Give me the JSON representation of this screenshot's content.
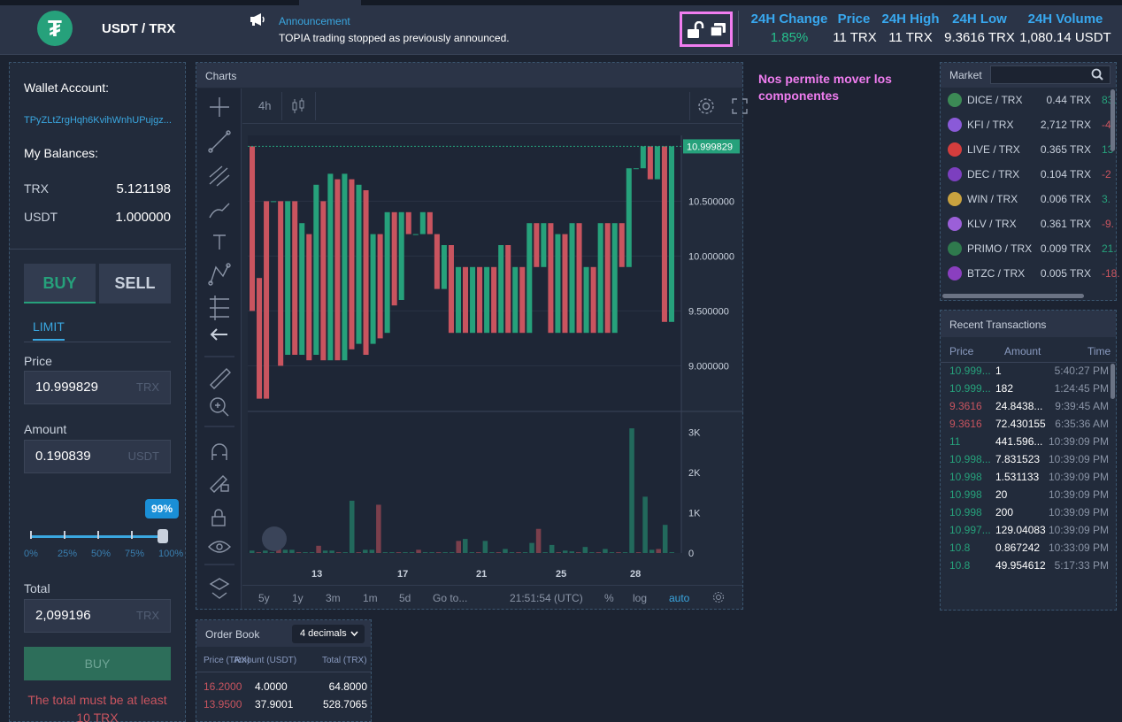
{
  "header": {
    "pair": "USDT / TRX",
    "announcement_title": "Announcement",
    "announcement_text": "TOPIA trading stopped as previously announced.",
    "stats": [
      {
        "label": "24H Change",
        "value": "1.85%"
      },
      {
        "label": "Price",
        "value": "11 TRX"
      },
      {
        "label": "24H High",
        "value": "11 TRX"
      },
      {
        "label": "24H Low",
        "value": "9.3616 TRX"
      },
      {
        "label": "24H Volume",
        "value": "1,080.14 USDT"
      }
    ]
  },
  "annotation_note": "Nos permite mover los componentes",
  "wallet": {
    "title": "Wallet Account:",
    "address": "TPyZLtZrgHqh6KvihWnhUPujgz...",
    "balances_title": "My Balances:",
    "balances": [
      {
        "asset": "TRX",
        "amount": "5.121198"
      },
      {
        "asset": "USDT",
        "amount": "1.000000"
      }
    ]
  },
  "trade": {
    "buy_tab": "BUY",
    "sell_tab": "SELL",
    "order_type": "LIMIT",
    "price_label": "Price",
    "price_value": "10.999829",
    "price_unit": "TRX",
    "amount_label": "Amount",
    "amount_value": "0.190839",
    "amount_unit": "USDT",
    "slider_pct": "99%",
    "slider_value": 0.99,
    "slider_marks": [
      "0%",
      "25%",
      "50%",
      "75%",
      "100%"
    ],
    "total_label": "Total",
    "total_value": "2,099196",
    "total_unit": "TRX",
    "submit_label": "BUY",
    "error": "The total must be at least 10 TRX"
  },
  "chart": {
    "title": "Charts",
    "interval": "4h",
    "last_price_label": "10.999829",
    "price_ticks": [
      "10.500000",
      "10.000000",
      "9.500000",
      "9.000000"
    ],
    "volume_ticks": [
      "3K",
      "2K",
      "1K",
      "0"
    ],
    "x_ticks": [
      "13",
      "17",
      "21",
      "25",
      "28"
    ],
    "ranges": [
      "5y",
      "1y",
      "3m",
      "1m",
      "5d",
      "Go to..."
    ],
    "time": "21:51:54 (UTC)",
    "pct": "%",
    "log": "log",
    "auto": "auto"
  },
  "chart_data": {
    "type": "candlestick",
    "title": "",
    "ylim": [
      8.6,
      11.1
    ],
    "volume_ylim": [
      0,
      3300
    ],
    "x_tick_labels": [
      "13",
      "17",
      "21",
      "25",
      "28"
    ],
    "candles": [
      [
        11.0,
        10.95,
        9.5,
        9.5
      ],
      [
        9.8,
        9.8,
        8.7,
        8.7
      ],
      [
        10.5,
        10.5,
        8.7,
        8.7
      ],
      [
        10.5,
        10.5,
        10.5,
        10.5
      ],
      [
        10.5,
        10.5,
        9.0,
        9.0
      ],
      [
        9.1,
        10.5,
        9.1,
        10.5
      ],
      [
        10.5,
        10.5,
        9.1,
        9.1
      ],
      [
        9.1,
        10.3,
        9.1,
        10.3
      ],
      [
        10.2,
        10.2,
        9.05,
        9.05
      ],
      [
        9.1,
        10.65,
        9.1,
        10.65
      ],
      [
        10.5,
        10.5,
        9.05,
        9.05
      ],
      [
        9.05,
        10.75,
        9.05,
        10.75
      ],
      [
        10.7,
        10.7,
        9.05,
        9.05
      ],
      [
        9.05,
        10.75,
        9.05,
        10.75
      ],
      [
        10.7,
        10.7,
        9.15,
        9.15
      ],
      [
        9.2,
        10.65,
        9.2,
        10.65
      ],
      [
        10.6,
        10.6,
        9.1,
        9.1
      ],
      [
        9.2,
        10.2,
        9.2,
        10.2
      ],
      [
        10.2,
        10.2,
        9.25,
        9.25
      ],
      [
        9.3,
        10.4,
        9.3,
        10.4
      ],
      [
        10.4,
        10.4,
        9.55,
        9.55
      ],
      [
        9.6,
        10.4,
        9.6,
        10.4
      ],
      [
        10.4,
        10.4,
        10.2,
        10.2
      ],
      [
        10.2,
        10.2,
        10.2,
        10.2
      ],
      [
        10.2,
        10.4,
        10.2,
        10.4
      ],
      [
        10.4,
        10.4,
        10.2,
        10.2
      ],
      [
        10.2,
        10.2,
        9.7,
        9.7
      ],
      [
        9.7,
        10.1,
        9.7,
        10.1
      ],
      [
        10.1,
        10.1,
        9.3,
        9.3
      ],
      [
        9.3,
        9.9,
        9.3,
        9.9
      ],
      [
        9.9,
        9.9,
        9.3,
        9.3
      ],
      [
        9.3,
        9.9,
        9.3,
        9.9
      ],
      [
        9.9,
        9.9,
        9.3,
        9.3
      ],
      [
        9.3,
        9.9,
        9.3,
        9.9
      ],
      [
        9.9,
        9.9,
        9.3,
        9.3
      ],
      [
        9.3,
        10.1,
        9.3,
        10.1
      ],
      [
        10.1,
        10.1,
        9.3,
        9.3
      ],
      [
        9.3,
        9.9,
        9.3,
        9.9
      ],
      [
        9.9,
        9.9,
        9.3,
        9.3
      ],
      [
        9.3,
        10.3,
        9.3,
        10.3
      ],
      [
        10.3,
        10.3,
        9.9,
        9.9
      ],
      [
        9.9,
        10.3,
        9.9,
        10.3
      ],
      [
        10.3,
        10.3,
        9.3,
        9.3
      ],
      [
        9.3,
        10.2,
        9.3,
        10.2
      ],
      [
        10.2,
        10.2,
        9.3,
        9.3
      ],
      [
        9.3,
        10.3,
        9.3,
        10.3
      ],
      [
        10.3,
        10.3,
        9.3,
        9.3
      ],
      [
        9.3,
        9.9,
        9.3,
        9.9
      ],
      [
        9.9,
        9.9,
        9.3,
        9.3
      ],
      [
        9.3,
        10.3,
        9.3,
        10.3
      ],
      [
        10.3,
        10.3,
        9.3,
        9.3
      ],
      [
        9.3,
        10.3,
        9.3,
        10.3
      ],
      [
        10.3,
        10.3,
        9.9,
        9.9
      ],
      [
        9.9,
        10.8,
        9.9,
        10.8
      ],
      [
        10.8,
        10.8,
        10.8,
        10.8
      ],
      [
        10.8,
        11.0,
        10.8,
        11.0
      ],
      [
        11.0,
        11.0,
        10.7,
        10.7
      ],
      [
        10.7,
        11.0,
        10.7,
        11.0
      ],
      [
        11.0,
        11.0,
        9.4,
        9.4
      ],
      [
        9.4,
        11.0,
        9.4,
        11.0
      ]
    ],
    "volumes": [
      60,
      20,
      60,
      20,
      250,
      80,
      80,
      20,
      20,
      20,
      180,
      60,
      60,
      20,
      20,
      1300,
      20,
      80,
      80,
      1200,
      20,
      20,
      20,
      20,
      20,
      80,
      20,
      20,
      20,
      20,
      20,
      300,
      350,
      20,
      20,
      300,
      20,
      20,
      100,
      20,
      20,
      20,
      250,
      600,
      20,
      200,
      20,
      60,
      40,
      20,
      150,
      20,
      20,
      100,
      20,
      20,
      20,
      3100,
      20,
      1400,
      80,
      100,
      700,
      20
    ]
  },
  "market": {
    "title": "Market",
    "rows": [
      {
        "pair": "DICE / TRX",
        "price": "0.44 TRX",
        "change": "83.",
        "color": "#26a17b",
        "icon": "#3c8a55"
      },
      {
        "pair": "KFI / TRX",
        "price": "2,712 TRX",
        "change": "-4.",
        "color": "#c9545f",
        "icon": "#8a5ad8"
      },
      {
        "pair": "LIVE / TRX",
        "price": "0.365 TRX",
        "change": "13",
        "color": "#26a17b",
        "icon": "#d43d3d"
      },
      {
        "pair": "DEC / TRX",
        "price": "0.104 TRX",
        "change": "-2",
        "color": "#c9545f",
        "icon": "#7c3fbf"
      },
      {
        "pair": "WIN / TRX",
        "price": "0.006 TRX",
        "change": "3.",
        "color": "#26a17b",
        "icon": "#c9a23f"
      },
      {
        "pair": "KLV / TRX",
        "price": "0.361 TRX",
        "change": "-9.",
        "color": "#c9545f",
        "icon": "#9b5fd8"
      },
      {
        "pair": "PRIMO / TRX",
        "price": "0.009 TRX",
        "change": "21.",
        "color": "#26a17b",
        "icon": "#2f7a4d"
      },
      {
        "pair": "BTZC / TRX",
        "price": "0.005 TRX",
        "change": "-18.",
        "color": "#c9545f",
        "icon": "#8a3fbf"
      }
    ]
  },
  "recent": {
    "title": "Recent Transactions",
    "cols": [
      "Price",
      "Amount",
      "Time"
    ],
    "rows": [
      {
        "p": "10.999...",
        "a": "1",
        "t": "5:40:27 PM",
        "c": "#26a17b"
      },
      {
        "p": "10.999...",
        "a": "182",
        "t": "1:24:45 PM",
        "c": "#26a17b"
      },
      {
        "p": "9.3616",
        "a": "24.8438...",
        "t": "9:39:45 AM",
        "c": "#c9545f"
      },
      {
        "p": "9.3616",
        "a": "72.430155",
        "t": "6:35:36 AM",
        "c": "#c9545f"
      },
      {
        "p": "11",
        "a": "441.596...",
        "t": "10:39:09 PM",
        "c": "#26a17b"
      },
      {
        "p": "10.998...",
        "a": "7.831523",
        "t": "10:39:09 PM",
        "c": "#26a17b"
      },
      {
        "p": "10.998",
        "a": "1.531133",
        "t": "10:39:09 PM",
        "c": "#26a17b"
      },
      {
        "p": "10.998",
        "a": "20",
        "t": "10:39:09 PM",
        "c": "#26a17b"
      },
      {
        "p": "10.998",
        "a": "200",
        "t": "10:39:09 PM",
        "c": "#26a17b"
      },
      {
        "p": "10.997...",
        "a": "129.04083",
        "t": "10:39:09 PM",
        "c": "#26a17b"
      },
      {
        "p": "10.8",
        "a": "0.867242",
        "t": "10:33:09 PM",
        "c": "#26a17b"
      },
      {
        "p": "10.8",
        "a": "49.954612",
        "t": "5:17:33 PM",
        "c": "#26a17b"
      }
    ]
  },
  "orderbook": {
    "title": "Order Book",
    "decimals": "4 decimals",
    "cols": [
      "Price (TRX)",
      "Amount (USDT)",
      "Total (TRX)"
    ],
    "rows": [
      {
        "p": "16.2000",
        "a": "4.0000",
        "t": "64.8000"
      },
      {
        "p": "13.9500",
        "a": "37.9001",
        "t": "528.7065"
      }
    ]
  },
  "colors": {
    "up": "#26a17b",
    "down": "#c9545f",
    "accent": "#38a8ef"
  }
}
